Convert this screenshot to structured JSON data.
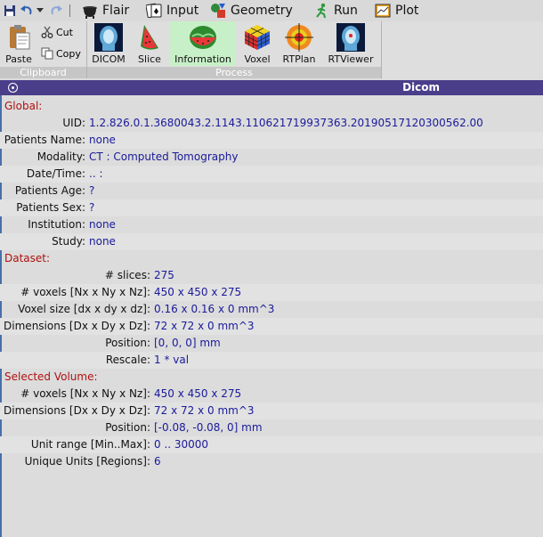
{
  "menubar": {
    "items": [
      {
        "label": "Flair",
        "icon": "cauldron-icon"
      },
      {
        "label": "Input",
        "icon": "playing-cards-icon"
      },
      {
        "label": "Geometry",
        "icon": "shapes-icon"
      },
      {
        "label": "Run",
        "icon": "running-man-icon"
      },
      {
        "label": "Plot",
        "icon": "plot-icon"
      }
    ]
  },
  "ribbon": {
    "clipboard": {
      "label": "Clipboard",
      "paste": "Paste",
      "cut": "Cut",
      "copy": "Copy"
    },
    "process": {
      "label": "Process",
      "tools": [
        {
          "label": "DICOM",
          "icon": "dicom-head-icon"
        },
        {
          "label": "Slice",
          "icon": "watermelon-slice-icon"
        },
        {
          "label": "Information",
          "icon": "watermelon-icon"
        },
        {
          "label": "Voxel",
          "icon": "rubik-cube-icon"
        },
        {
          "label": "RTPlan",
          "icon": "target-icon"
        },
        {
          "label": "RTViewer",
          "icon": "rt-head-icon"
        }
      ]
    }
  },
  "panel": {
    "title": "Dicom",
    "global": {
      "heading": "Global:",
      "rows": [
        {
          "label": "UID:",
          "value": "1.2.826.0.1.3680043.2.1143.110621719937363.20190517120300562.00"
        },
        {
          "label": "Patients Name:",
          "value": "none"
        },
        {
          "label": "Modality:",
          "value": "CT : Computed Tomography"
        },
        {
          "label": "Date/Time:",
          "value": ".. :"
        },
        {
          "label": "Patients Age:",
          "value": "?"
        },
        {
          "label": "Patients Sex:",
          "value": "?"
        },
        {
          "label": "Institution:",
          "value": "none"
        },
        {
          "label": "Study:",
          "value": "none"
        }
      ]
    },
    "dataset": {
      "heading": "Dataset:",
      "rows": [
        {
          "label": "# slices:",
          "value": "275"
        },
        {
          "label": "# voxels [Nx x Ny x Nz]:",
          "value": "450 x 450 x 275"
        },
        {
          "label": "Voxel size [dx x dy x dz]:",
          "value": "0.16 x 0.16 x 0 mm^3"
        },
        {
          "label": "Dimensions [Dx x Dy x Dz]:",
          "value": "72 x 72 x 0 mm^3"
        },
        {
          "label": "Position:",
          "value": "[0, 0, 0] mm"
        },
        {
          "label": "Rescale:",
          "value": "1 * val"
        }
      ]
    },
    "selected": {
      "heading": "Selected Volume:",
      "rows": [
        {
          "label": "# voxels [Nx x Ny x Nz]:",
          "value": "450 x 450 x 275"
        },
        {
          "label": "Dimensions [Dx x Dy x Dz]:",
          "value": "72 x 72 x 0 mm^3"
        },
        {
          "label": "Position:",
          "value": "[-0.08, -0.08, 0] mm"
        },
        {
          "label": "Unit range [Min..Max]:",
          "value": "0 .. 30000"
        },
        {
          "label": "Unique Units [Regions]:",
          "value": "6"
        }
      ]
    }
  }
}
